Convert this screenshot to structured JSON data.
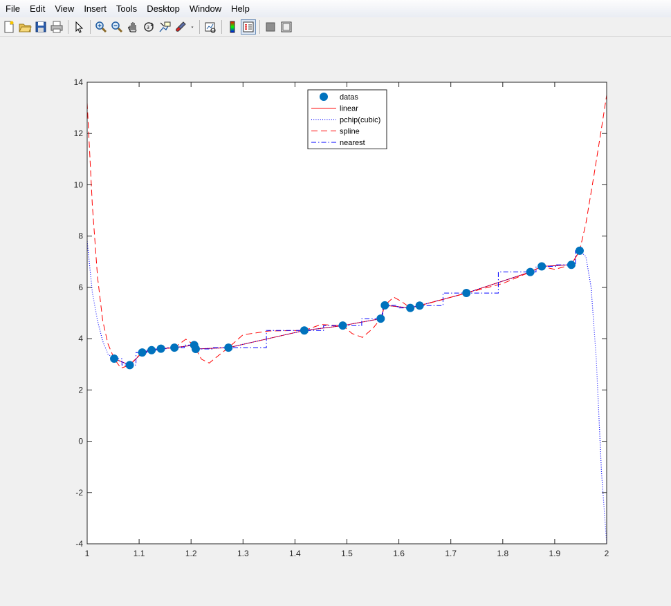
{
  "menu": [
    "File",
    "Edit",
    "View",
    "Insert",
    "Tools",
    "Desktop",
    "Window",
    "Help"
  ],
  "toolbar": [
    {
      "name": "new-figure-icon"
    },
    {
      "name": "open-file-icon"
    },
    {
      "name": "save-icon"
    },
    {
      "name": "print-icon"
    },
    {
      "sep": true
    },
    {
      "name": "pointer-icon"
    },
    {
      "sep": true
    },
    {
      "name": "zoom-in-icon"
    },
    {
      "name": "zoom-out-icon"
    },
    {
      "name": "pan-hand-icon"
    },
    {
      "name": "rotate-3d-icon"
    },
    {
      "name": "data-cursor-icon"
    },
    {
      "name": "brush-icon"
    },
    {
      "name": "dropdown-arrow-icon"
    },
    {
      "sep": true
    },
    {
      "name": "link-plot-icon"
    },
    {
      "sep": true
    },
    {
      "name": "colorbar-icon"
    },
    {
      "name": "legend-icon",
      "pressed": true
    },
    {
      "sep": true
    },
    {
      "name": "hide-plot-tools-icon"
    },
    {
      "name": "show-plot-tools-icon"
    }
  ],
  "chart_data": {
    "type": "line",
    "xlim": [
      1,
      2
    ],
    "ylim": [
      -4,
      14
    ],
    "xticks": [
      1,
      1.1,
      1.2,
      1.3,
      1.4,
      1.5,
      1.6,
      1.7,
      1.8,
      1.9,
      2
    ],
    "xtick_labels": [
      "1",
      "1.1",
      "1.2",
      "1.3",
      "1.4",
      "1.5",
      "1.6",
      "1.7",
      "1.8",
      "1.9",
      "2"
    ],
    "yticks": [
      -4,
      -2,
      0,
      2,
      4,
      6,
      8,
      10,
      12,
      14
    ],
    "ytick_labels": [
      "-4",
      "-2",
      "0",
      "2",
      "4",
      "6",
      "8",
      "10",
      "12",
      "14"
    ],
    "legend_position": "top-center",
    "colors": {
      "datas": "#0072bd",
      "linear": "#ff0000",
      "pchip": "#0000ff",
      "spline": "#ff0000",
      "nearest": "#0000ff"
    },
    "datas": {
      "x": [
        1.052,
        1.082,
        1.106,
        1.124,
        1.142,
        1.168,
        1.206,
        1.209,
        1.272,
        1.418,
        1.492,
        1.565,
        1.573,
        1.622,
        1.64,
        1.73,
        1.853,
        1.875,
        1.932,
        1.948
      ],
      "y": [
        3.22,
        2.97,
        3.46,
        3.55,
        3.61,
        3.65,
        3.75,
        3.6,
        3.65,
        4.32,
        4.51,
        4.78,
        5.3,
        5.2,
        5.29,
        5.78,
        6.6,
        6.82,
        6.88,
        7.43
      ]
    },
    "series": [
      {
        "name": "datas",
        "style": "marker"
      },
      {
        "name": "linear",
        "style": "solid"
      },
      {
        "name": "pchip(cubic)",
        "style": "dotted",
        "x": [
          1.0,
          1.01,
          1.02,
          1.03,
          1.04,
          1.05,
          1.052,
          1.082,
          1.106,
          1.124,
          1.142,
          1.168,
          1.206,
          1.209,
          1.272,
          1.418,
          1.492,
          1.565,
          1.573,
          1.622,
          1.64,
          1.73,
          1.853,
          1.875,
          1.932,
          1.948,
          1.96,
          1.97,
          1.98,
          1.99,
          2.0
        ],
        "y": [
          7.8,
          5.8,
          4.7,
          3.9,
          3.4,
          3.25,
          3.22,
          2.97,
          3.46,
          3.55,
          3.61,
          3.65,
          3.75,
          3.6,
          3.65,
          4.32,
          4.51,
          4.78,
          5.3,
          5.2,
          5.29,
          5.78,
          6.6,
          6.82,
          6.88,
          7.43,
          7.2,
          6.0,
          3.2,
          -1.2,
          -4.0
        ]
      },
      {
        "name": "spline",
        "style": "dashed",
        "x": [
          1.0,
          1.01,
          1.02,
          1.03,
          1.04,
          1.052,
          1.065,
          1.082,
          1.095,
          1.106,
          1.124,
          1.142,
          1.168,
          1.19,
          1.206,
          1.209,
          1.22,
          1.235,
          1.25,
          1.272,
          1.3,
          1.35,
          1.418,
          1.45,
          1.492,
          1.51,
          1.53,
          1.55,
          1.565,
          1.573,
          1.59,
          1.605,
          1.622,
          1.64,
          1.68,
          1.73,
          1.8,
          1.853,
          1.875,
          1.9,
          1.932,
          1.948,
          1.96,
          1.975,
          1.99,
          2.0
        ],
        "y": [
          13.2,
          9.2,
          6.4,
          4.7,
          3.8,
          3.22,
          2.85,
          2.97,
          3.25,
          3.46,
          3.55,
          3.61,
          3.65,
          3.98,
          3.75,
          3.6,
          3.2,
          3.05,
          3.3,
          3.65,
          4.15,
          4.3,
          4.32,
          4.55,
          4.51,
          4.2,
          4.05,
          4.4,
          4.78,
          5.3,
          5.62,
          5.45,
          5.2,
          5.29,
          5.5,
          5.78,
          6.15,
          6.6,
          6.82,
          6.7,
          6.88,
          7.43,
          8.5,
          10.3,
          12.2,
          13.5
        ]
      },
      {
        "name": "nearest",
        "style": "dashdot",
        "x": [
          1.052,
          1.067,
          1.067,
          1.094,
          1.094,
          1.115,
          1.115,
          1.133,
          1.133,
          1.155,
          1.155,
          1.187,
          1.187,
          1.2075,
          1.2075,
          1.2405,
          1.2405,
          1.345,
          1.345,
          1.455,
          1.455,
          1.5285,
          1.5285,
          1.569,
          1.569,
          1.5975,
          1.5975,
          1.631,
          1.631,
          1.685,
          1.685,
          1.7915,
          1.7915,
          1.864,
          1.864,
          1.9035,
          1.9035,
          1.94,
          1.94,
          1.948
        ],
        "y": [
          3.22,
          3.22,
          2.97,
          2.97,
          3.46,
          3.46,
          3.55,
          3.55,
          3.61,
          3.61,
          3.65,
          3.65,
          3.75,
          3.75,
          3.6,
          3.6,
          3.65,
          3.65,
          4.32,
          4.32,
          4.51,
          4.51,
          4.78,
          4.78,
          5.3,
          5.3,
          5.2,
          5.2,
          5.29,
          5.29,
          5.78,
          5.78,
          6.6,
          6.6,
          6.82,
          6.82,
          6.88,
          6.88,
          7.43,
          7.43
        ]
      }
    ]
  }
}
